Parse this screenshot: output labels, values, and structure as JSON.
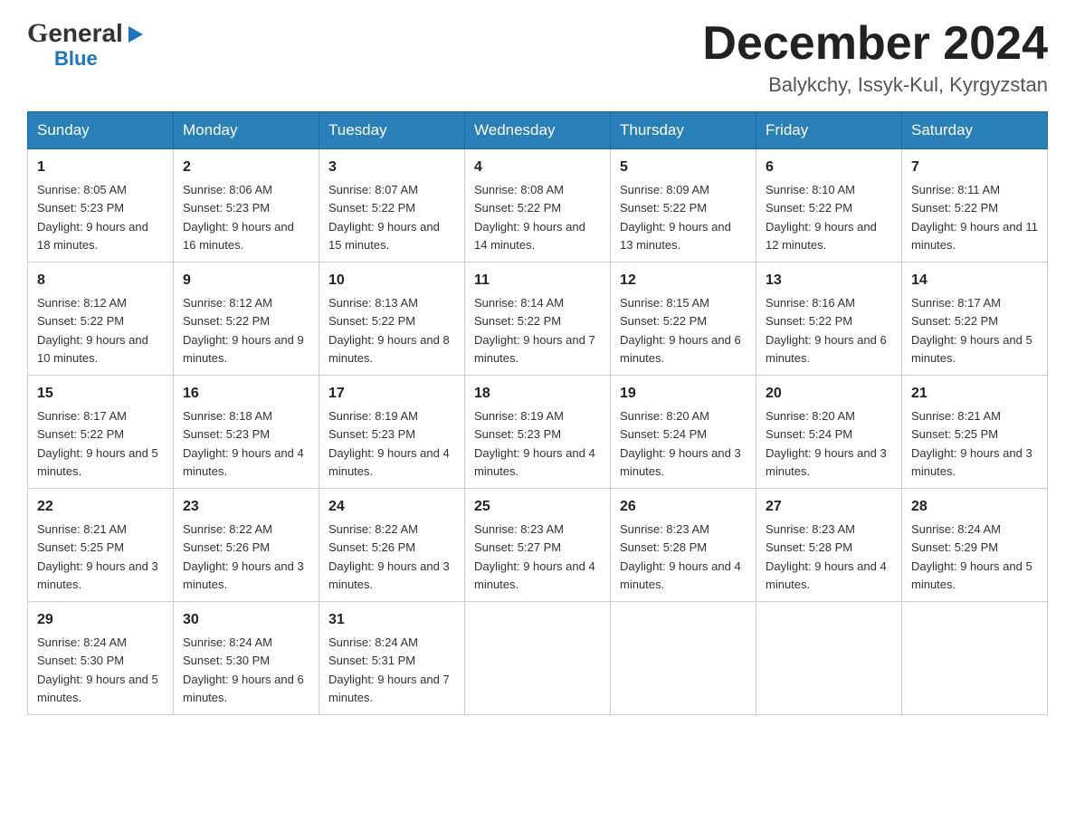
{
  "header": {
    "logo_general": "General",
    "logo_blue": "Blue",
    "title": "December 2024",
    "subtitle": "Balykchy, Issyk-Kul, Kyrgyzstan"
  },
  "days_of_week": [
    "Sunday",
    "Monday",
    "Tuesday",
    "Wednesday",
    "Thursday",
    "Friday",
    "Saturday"
  ],
  "weeks": [
    [
      {
        "day": "1",
        "sunrise": "8:05 AM",
        "sunset": "5:23 PM",
        "daylight": "9 hours and 18 minutes."
      },
      {
        "day": "2",
        "sunrise": "8:06 AM",
        "sunset": "5:23 PM",
        "daylight": "9 hours and 16 minutes."
      },
      {
        "day": "3",
        "sunrise": "8:07 AM",
        "sunset": "5:22 PM",
        "daylight": "9 hours and 15 minutes."
      },
      {
        "day": "4",
        "sunrise": "8:08 AM",
        "sunset": "5:22 PM",
        "daylight": "9 hours and 14 minutes."
      },
      {
        "day": "5",
        "sunrise": "8:09 AM",
        "sunset": "5:22 PM",
        "daylight": "9 hours and 13 minutes."
      },
      {
        "day": "6",
        "sunrise": "8:10 AM",
        "sunset": "5:22 PM",
        "daylight": "9 hours and 12 minutes."
      },
      {
        "day": "7",
        "sunrise": "8:11 AM",
        "sunset": "5:22 PM",
        "daylight": "9 hours and 11 minutes."
      }
    ],
    [
      {
        "day": "8",
        "sunrise": "8:12 AM",
        "sunset": "5:22 PM",
        "daylight": "9 hours and 10 minutes."
      },
      {
        "day": "9",
        "sunrise": "8:12 AM",
        "sunset": "5:22 PM",
        "daylight": "9 hours and 9 minutes."
      },
      {
        "day": "10",
        "sunrise": "8:13 AM",
        "sunset": "5:22 PM",
        "daylight": "9 hours and 8 minutes."
      },
      {
        "day": "11",
        "sunrise": "8:14 AM",
        "sunset": "5:22 PM",
        "daylight": "9 hours and 7 minutes."
      },
      {
        "day": "12",
        "sunrise": "8:15 AM",
        "sunset": "5:22 PM",
        "daylight": "9 hours and 6 minutes."
      },
      {
        "day": "13",
        "sunrise": "8:16 AM",
        "sunset": "5:22 PM",
        "daylight": "9 hours and 6 minutes."
      },
      {
        "day": "14",
        "sunrise": "8:17 AM",
        "sunset": "5:22 PM",
        "daylight": "9 hours and 5 minutes."
      }
    ],
    [
      {
        "day": "15",
        "sunrise": "8:17 AM",
        "sunset": "5:22 PM",
        "daylight": "9 hours and 5 minutes."
      },
      {
        "day": "16",
        "sunrise": "8:18 AM",
        "sunset": "5:23 PM",
        "daylight": "9 hours and 4 minutes."
      },
      {
        "day": "17",
        "sunrise": "8:19 AM",
        "sunset": "5:23 PM",
        "daylight": "9 hours and 4 minutes."
      },
      {
        "day": "18",
        "sunrise": "8:19 AM",
        "sunset": "5:23 PM",
        "daylight": "9 hours and 4 minutes."
      },
      {
        "day": "19",
        "sunrise": "8:20 AM",
        "sunset": "5:24 PM",
        "daylight": "9 hours and 3 minutes."
      },
      {
        "day": "20",
        "sunrise": "8:20 AM",
        "sunset": "5:24 PM",
        "daylight": "9 hours and 3 minutes."
      },
      {
        "day": "21",
        "sunrise": "8:21 AM",
        "sunset": "5:25 PM",
        "daylight": "9 hours and 3 minutes."
      }
    ],
    [
      {
        "day": "22",
        "sunrise": "8:21 AM",
        "sunset": "5:25 PM",
        "daylight": "9 hours and 3 minutes."
      },
      {
        "day": "23",
        "sunrise": "8:22 AM",
        "sunset": "5:26 PM",
        "daylight": "9 hours and 3 minutes."
      },
      {
        "day": "24",
        "sunrise": "8:22 AM",
        "sunset": "5:26 PM",
        "daylight": "9 hours and 3 minutes."
      },
      {
        "day": "25",
        "sunrise": "8:23 AM",
        "sunset": "5:27 PM",
        "daylight": "9 hours and 4 minutes."
      },
      {
        "day": "26",
        "sunrise": "8:23 AM",
        "sunset": "5:28 PM",
        "daylight": "9 hours and 4 minutes."
      },
      {
        "day": "27",
        "sunrise": "8:23 AM",
        "sunset": "5:28 PM",
        "daylight": "9 hours and 4 minutes."
      },
      {
        "day": "28",
        "sunrise": "8:24 AM",
        "sunset": "5:29 PM",
        "daylight": "9 hours and 5 minutes."
      }
    ],
    [
      {
        "day": "29",
        "sunrise": "8:24 AM",
        "sunset": "5:30 PM",
        "daylight": "9 hours and 5 minutes."
      },
      {
        "day": "30",
        "sunrise": "8:24 AM",
        "sunset": "5:30 PM",
        "daylight": "9 hours and 6 minutes."
      },
      {
        "day": "31",
        "sunrise": "8:24 AM",
        "sunset": "5:31 PM",
        "daylight": "9 hours and 7 minutes."
      },
      null,
      null,
      null,
      null
    ]
  ]
}
